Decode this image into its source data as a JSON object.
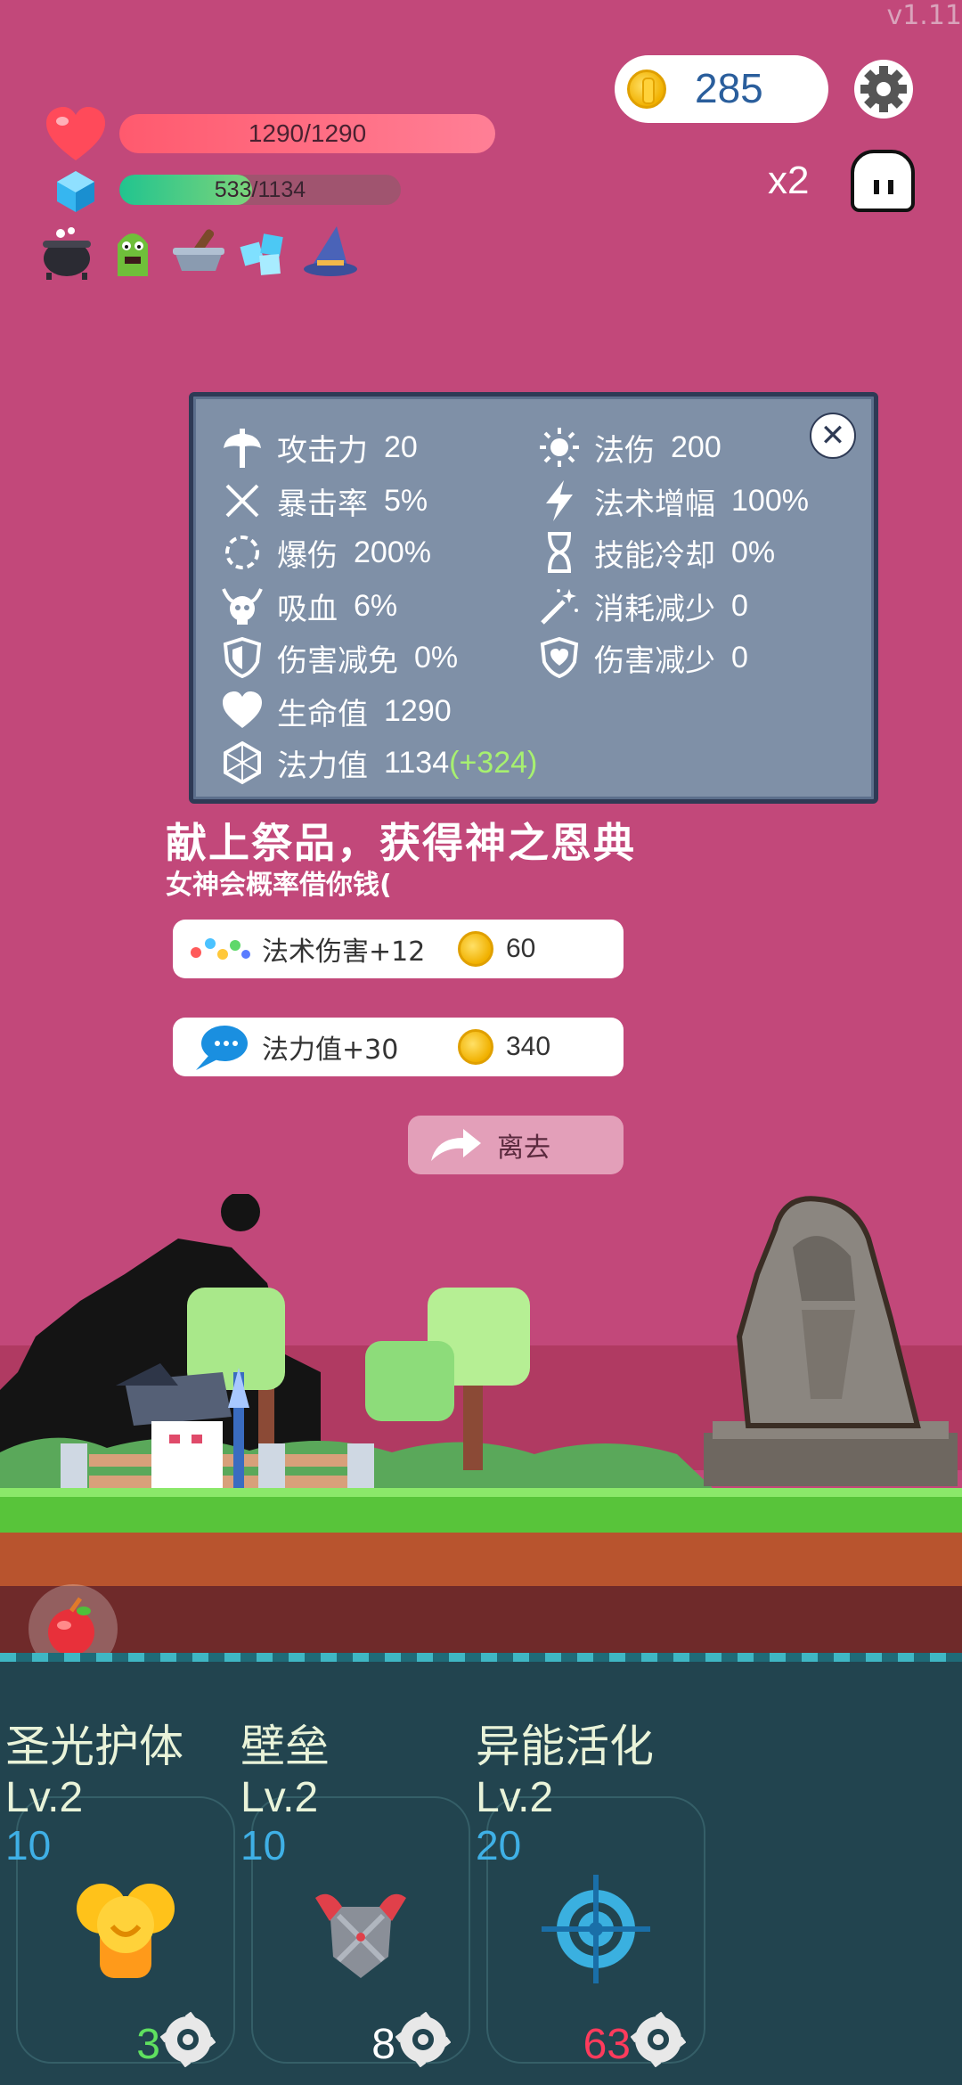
{
  "version": "v1.11",
  "hud": {
    "coins": "285",
    "hp_text": "1290/1290",
    "hp_fraction": 1.0,
    "mp_text": "533/1134",
    "mp_fraction": 0.47,
    "multiplier": "x2",
    "buffs": [
      "cauldron-icon",
      "green-monster-icon",
      "mortar-icon",
      "ice-cubes-icon",
      "wizard-hat-icon"
    ]
  },
  "stats": {
    "left": [
      {
        "icon": "axe-icon",
        "label": "攻击力",
        "value": "20"
      },
      {
        "icon": "crossed-swords-icon",
        "label": "暴击率",
        "value": "5%"
      },
      {
        "icon": "burst-ring-icon",
        "label": "爆伤",
        "value": "200%"
      },
      {
        "icon": "skull-horns-icon",
        "label": "吸血",
        "value": "6%"
      },
      {
        "icon": "shield-icon",
        "label": "伤害减免",
        "value": "0%"
      },
      {
        "icon": "heart-icon",
        "label": "生命值",
        "value": "1290"
      },
      {
        "icon": "hexagon-icon",
        "label": "法力值",
        "value": "1134",
        "bonus": "(+324)"
      }
    ],
    "right": [
      {
        "icon": "sun-icon",
        "label": "法伤",
        "value": "200"
      },
      {
        "icon": "lightning-icon",
        "label": "法术增幅",
        "value": "100%"
      },
      {
        "icon": "hourglass-icon",
        "label": "技能冷却",
        "value": "0%"
      },
      {
        "icon": "magic-wand-icon",
        "label": "消耗减少",
        "value": "0"
      },
      {
        "icon": "heart-shield-icon",
        "label": "伤害减少",
        "value": "0"
      }
    ]
  },
  "offering": {
    "title": "献上祭品，获得神之恩典",
    "subtitle": "女神会概率借你钱(",
    "options": [
      {
        "icon": "color-dots-icon",
        "label": "法术伤害+12",
        "cost": "60"
      },
      {
        "icon": "chat-bubble-icon",
        "label": "法力值+30",
        "cost": "340"
      }
    ],
    "leave_label": "离去"
  },
  "skills": [
    {
      "name": "圣光护体",
      "level": "Lv.2",
      "cost": "10",
      "count": "3",
      "count_color": "#5fe05f",
      "icon": "golden-helmets-icon"
    },
    {
      "name": "壁垒",
      "level": "Lv.2",
      "cost": "10",
      "count": "8",
      "count_color": "#ffffff",
      "icon": "armor-icon"
    },
    {
      "name": "异能活化",
      "level": "Lv.2",
      "cost": "20",
      "count": "63",
      "count_color": "#ff3b5c",
      "icon": "crosshair-icon"
    }
  ]
}
